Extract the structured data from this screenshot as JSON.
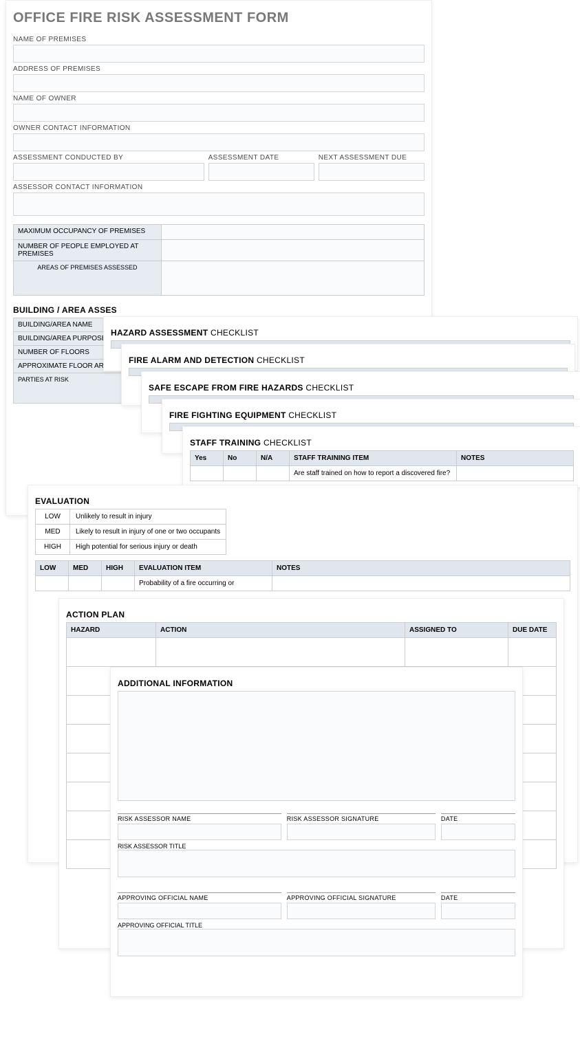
{
  "title": "OFFICE FIRE RISK ASSESSMENT FORM",
  "form": {
    "premises_name_label": "NAME OF PREMISES",
    "premises_address_label": "ADDRESS OF PREMISES",
    "owner_name_label": "NAME OF OWNER",
    "owner_contact_label": "OWNER CONTACT INFORMATION",
    "conducted_by_label": "ASSESSMENT CONDUCTED BY",
    "assessment_date_label": "ASSESSMENT DATE",
    "next_due_label": "NEXT ASSESSMENT DUE",
    "assessor_contact_label": "ASSESSOR CONTACT INFORMATION",
    "max_occ_label": "MAXIMUM OCCUPANCY OF PREMISES",
    "num_employed_label": "NUMBER OF PEOPLE EMPLOYED AT PREMISES",
    "areas_assessed_label": "AREAS OF PREMISES ASSESSED"
  },
  "building_area": {
    "heading_bold": "BUILDING / AREA ASSES",
    "name_label": "BUILDING/AREA NAME",
    "purpose_label": "BUILDING/AREA PURPOSE",
    "floors_label": "NUMBER OF FLOORS",
    "area_label": "APPROXIMATE FLOOR AREA",
    "parties_label": "PARTIES AT RISK"
  },
  "checklists": {
    "hazard_bold": "HAZARD ASSESSMENT",
    "hazard_thin": " CHECKLIST",
    "fire_alarm_bold": "FIRE ALARM AND DETECTION",
    "fire_alarm_thin": " CHECKLIST",
    "escape_bold": "SAFE ESCAPE FROM FIRE HAZARDS",
    "escape_thin": " CHECKLIST",
    "equipment_bold": "FIRE FIGHTING EQUIPMENT",
    "equipment_thin": " CHECKLIST",
    "training_bold": "STAFF TRAINING",
    "training_thin": " CHECKLIST",
    "cols": {
      "yes": "Yes",
      "no": "No",
      "na": "N/A",
      "item": "STAFF TRAINING ITEM",
      "notes": "NOTES"
    },
    "training_row1": "Are staff trained on how to report a discovered fire?"
  },
  "evaluation": {
    "heading": "EVALUATION",
    "legend": [
      {
        "lvl": "LOW",
        "desc": "Unlikely to result in injury"
      },
      {
        "lvl": "MED",
        "desc": "Likely to result in injury of one or two occupants"
      },
      {
        "lvl": "HIGH",
        "desc": "High potential for serious injury or death"
      }
    ],
    "cols": {
      "low": "LOW",
      "med": "MED",
      "high": "HIGH",
      "item": "EVALUATION ITEM",
      "notes": "NOTES"
    },
    "row1": "Probability of a fire occurring or"
  },
  "action_plan": {
    "heading": "ACTION PLAN",
    "cols": {
      "hazard": "HAZARD",
      "action": "ACTION",
      "assigned": "ASSIGNED TO",
      "due": "DUE DATE"
    }
  },
  "additional": {
    "heading": "ADDITIONAL INFORMATION",
    "risk_name": "RISK ASSESSOR NAME",
    "risk_sig": "RISK ASSESSOR SIGNATURE",
    "date": "DATE",
    "risk_title": "RISK ASSESSOR TITLE",
    "appr_name": "APPROVING OFFICIAL NAME",
    "appr_sig": "APPROVING OFFICIAL SIGNATURE",
    "appr_title": "APPROVING OFFICIAL TITLE"
  }
}
